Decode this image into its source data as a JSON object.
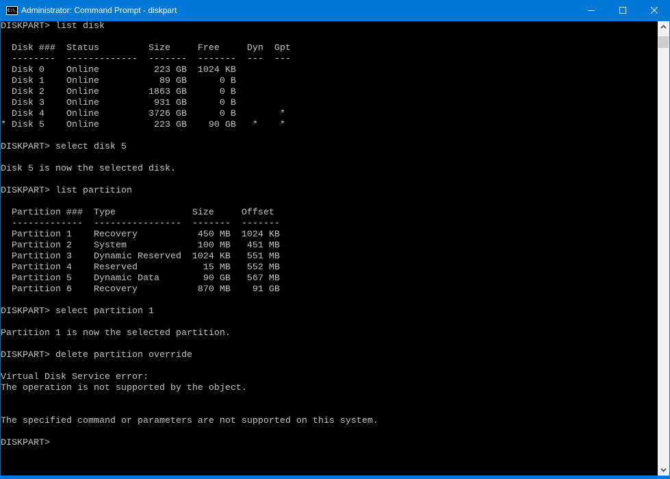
{
  "window": {
    "title": "Administrator: Command Prompt - diskpart",
    "icon_text": "C:\\_"
  },
  "colors": {
    "titlebar": "#0078d7",
    "console_bg": "#000000",
    "console_fg": "#c0c0c0"
  },
  "console": {
    "lines": [
      "DISKPART> list disk",
      "",
      "  Disk ###  Status         Size     Free     Dyn  Gpt",
      "  --------  -------------  -------  -------  ---  ---",
      "  Disk 0    Online          223 GB  1024 KB",
      "  Disk 1    Online           89 GB      0 B",
      "  Disk 2    Online         1863 GB      0 B",
      "  Disk 3    Online          931 GB      0 B",
      "  Disk 4    Online         3726 GB      0 B        *",
      "* Disk 5    Online          223 GB    90 GB   *    *",
      "",
      "DISKPART> select disk 5",
      "",
      "Disk 5 is now the selected disk.",
      "",
      "DISKPART> list partition",
      "",
      "  Partition ###  Type              Size     Offset",
      "  -------------  ----------------  -------  -------",
      "  Partition 1    Recovery           450 MB  1024 KB",
      "  Partition 2    System             100 MB   451 MB",
      "  Partition 3    Dynamic Reserved  1024 KB   551 MB",
      "  Partition 4    Reserved            15 MB   552 MB",
      "  Partition 5    Dynamic Data        90 GB   567 MB",
      "  Partition 6    Recovery           870 MB    91 GB",
      "",
      "DISKPART> select partition 1",
      "",
      "Partition 1 is now the selected partition.",
      "",
      "DISKPART> delete partition override",
      "",
      "Virtual Disk Service error:",
      "The operation is not supported by the object.",
      "",
      "",
      "The specified command or parameters are not supported on this system.",
      "",
      "DISKPART> "
    ]
  }
}
